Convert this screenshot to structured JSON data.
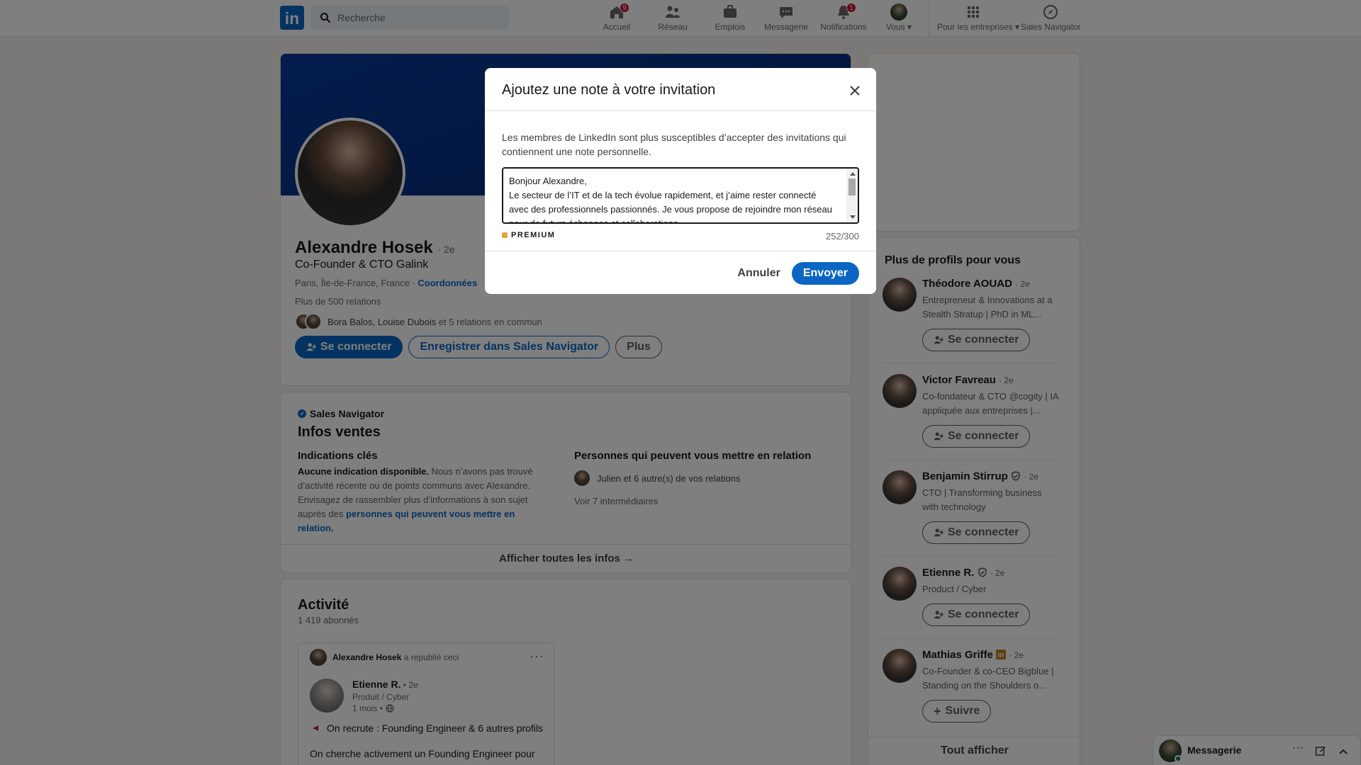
{
  "header": {
    "logo": "in",
    "search_placeholder": "Recherche",
    "nav": [
      {
        "label": "Accueil",
        "badge": "9"
      },
      {
        "label": "Réseau",
        "badge": ""
      },
      {
        "label": "Emplois",
        "badge": ""
      },
      {
        "label": "Messagerie",
        "badge": ""
      },
      {
        "label": "Notifications",
        "badge": "1"
      },
      {
        "label": "Vous ▾",
        "badge": ""
      },
      {
        "label": "Pour les entreprises ▾",
        "badge": ""
      },
      {
        "label": "Sales Navigator",
        "badge": ""
      }
    ]
  },
  "profile": {
    "name": "Alexandre Hosek",
    "degree": "· 2e",
    "headline": "Co-Founder & CTO Galink",
    "location": "Paris, Île-de-France, France · ",
    "contact_link": "Coordonnées",
    "relations": "Plus de 500 relations",
    "mutual_names": "Bora Balos, Louise Dubois",
    "mutual_rest": " et 5 relations en commun",
    "btn_connect": "Se connecter",
    "btn_save": "Enregistrer dans Sales Navigator",
    "btn_more": "Plus"
  },
  "sales": {
    "brand": "Sales Navigator",
    "title": "Infos ventes",
    "key_title": "Indications clés",
    "key_bold": "Aucune indication disponible.",
    "key_text": " Nous n’avons pas trouvé d’activité récente ou de points communs avec Alexandre. Envisagez de rassembler plus d’informations à son sujet auprès des ",
    "key_link": "personnes qui peuvent vous mettre en relation.",
    "intro_title": "Personnes qui peuvent vous mettre en relation",
    "intro_text": "Julien et 6 autre(s) de vos relations",
    "intro_more": "Voir 7 intermédiaires",
    "show_all": "Afficher toutes les infos →"
  },
  "activity": {
    "title": "Activité",
    "followers": "1 419 abonnés",
    "repost_by": "Alexandre Hosek",
    "repost_text": " a republié ceci",
    "post_author": "Etienne R.",
    "post_degree": " • 2e",
    "post_headline": "Produit / Cyber",
    "post_time": "1 mois •",
    "post_hiring": "On recrute : Founding Engineer & 6 autres profils",
    "post_body": "On cherche activement un Founding Engineer pour"
  },
  "pymk": {
    "title": "Plus de profils pour vous",
    "people": [
      {
        "name": "Théodore AOUAD",
        "degree": "· 2e",
        "headline": "Entrepreneur & Innovations at a Stealth Stratup | PhD in ML...",
        "action": "Se connecter"
      },
      {
        "name": "Victor Favreau",
        "degree": "· 2e",
        "headline": "Co-fondateur & CTO @cogity | IA appliquée aux entreprises |...",
        "action": "Se connecter"
      },
      {
        "name": "Benjamin Stirrup",
        "degree": "· 2e",
        "headline": "CTO | Transforming business with technology",
        "action": "Se connecter"
      },
      {
        "name": "Etienne R.",
        "degree": "· 2e",
        "headline": "Product / Cyber",
        "action": "Se connecter"
      },
      {
        "name": "Mathias Griffe",
        "degree": "· 2e",
        "headline": "Co-Founder & co-CEO Bigblue | Standing on the Shoulders o...",
        "action": "Suivre"
      }
    ],
    "show_all": "Tout afficher"
  },
  "modal": {
    "title": "Ajoutez une note à votre invitation",
    "description": "Les membres de LinkedIn sont plus susceptibles d’accepter des invitations qui contiennent une note personnelle.",
    "note": "Bonjour Alexandre,\nLe secteur de l’IT et de la tech évolue rapidement, et j’aime rester connecté avec des professionnels passionnés. Je vous propose de rejoindre mon réseau pour de futurs échanges et collaborations.",
    "premium": "PREMIUM",
    "counter": "252/300",
    "cancel": "Annuler",
    "send": "Envoyer"
  },
  "messaging": {
    "label": "Messagerie"
  },
  "colors": {
    "brand": "#0a66c2",
    "badge": "#cb112d",
    "premium": "#e7a33e"
  }
}
